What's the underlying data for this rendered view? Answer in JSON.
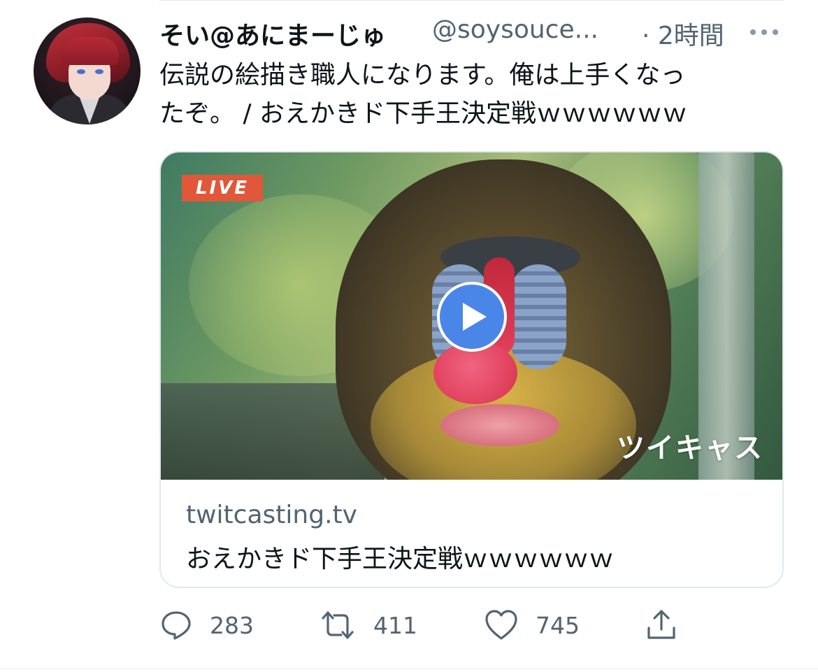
{
  "tweet": {
    "display_name": "そい@あにまーじゅ",
    "handle": "@soysouce...",
    "time": "· 2時間",
    "text_lines": [
      "伝説の絵描き職人になります。俺は上手くなっ",
      "たぞ。 / おえかきド下手王決定戦ｗｗｗｗｗｗ"
    ]
  },
  "card": {
    "live_label": "LIVE",
    "brand_mark": "ツイキャス",
    "domain": "twitcasting.tv",
    "title": "おえかきド下手王決定戦ｗｗｗｗｗｗ"
  },
  "actions": {
    "reply_count": "283",
    "retweet_count": "411",
    "like_count": "745"
  },
  "icons": {
    "reply": "speech-bubble-icon",
    "retweet": "retweet-arrows-icon",
    "like": "heart-icon",
    "share": "share-upload-icon",
    "more": "ellipsis-icon",
    "play": "play-icon"
  },
  "colors": {
    "live_badge": "#e1573a",
    "play_button": "#4a86e8",
    "secondary_text": "#536471"
  }
}
